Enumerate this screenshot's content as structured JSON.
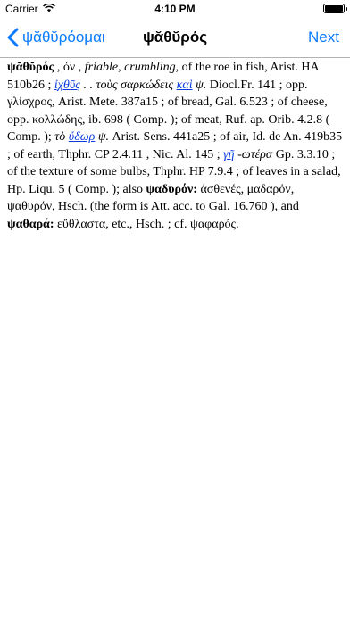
{
  "status_bar": {
    "carrier": "Carrier",
    "time": "4:10 PM",
    "icons": [
      "wifi-icon",
      "battery-icon"
    ]
  },
  "nav": {
    "back_label": "ψᾰθῠρόομαι",
    "title": "ψᾰθῠρός",
    "next_label": "Next",
    "accent_color": "#0a7afe"
  },
  "entry": {
    "lemma": "ψᾰθῠρός",
    "t01": " , όν , ",
    "t02": "friable, crumbling,",
    "t03": " of the roe in fish, Arist. HA 510b26 ; ",
    "l01": "ἰχθῦς",
    "t04": " . . ",
    "t05": "τοὺς σαρκώδεις",
    "t06": " ",
    "l02": "καὶ",
    "t07": " ψ.",
    "t08": " Diocl.Fr. 141 ; opp. γλίσχρος, Arist. Mete. 387a15 ; of bread, Gal. 6.523 ; of cheese, opp. κολλώδης, ib. 698 ( Comp. ); of meat, Ruf. ap. Orib. 4.2.8 ( Comp. ); ",
    "t09": "τὸ ",
    "l03": "ὕδωρ",
    "t10": " ψ.",
    "t11": " Arist. Sens. 441a25 ; of air, Id. de An. 419b35 ; of earth, Thphr. CP 2.4.11 , Nic. Al. 145 ; ",
    "l04": "γῆ",
    "t12": " -ωτέρα",
    "t13": " Gp. 3.3.10 ; of the texture of some bulbs, Thphr. HP 7.9.4 ; of leaves in a salad, Hp. Liqu. 5 ( Comp. ); also ",
    "b01": "ψαδυρόν:",
    "t14": " ἀσθενές, μαδαρόν, ψαθυρόν, Hsch. (the form is Att. acc. to Gal. 16.760 ), and ",
    "b02": "ψαθαρά:",
    "t15": " εὔθλαστα, etc., Hsch. ; cf. ψαφαρός."
  }
}
